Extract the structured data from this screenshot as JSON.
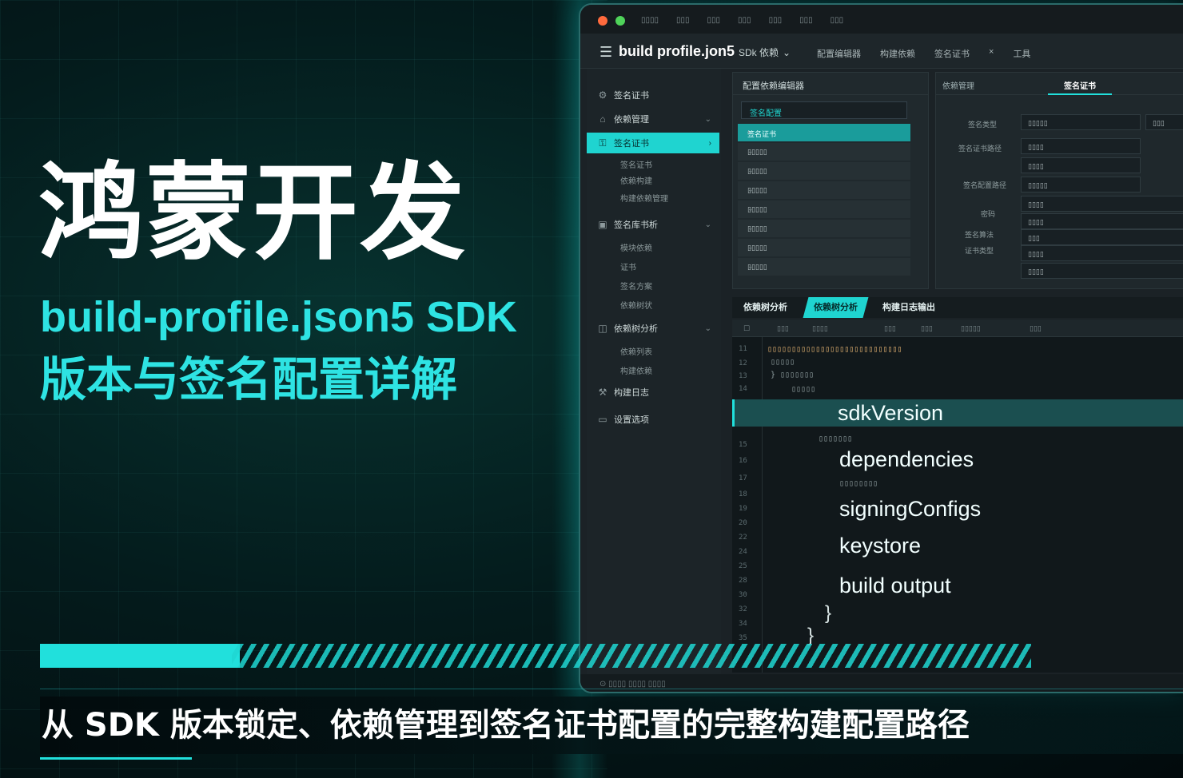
{
  "hero": {
    "title": "鸿蒙开发",
    "subtitle_line1": "build-profile.json5 SDK",
    "subtitle_line2": "版本与签名配置详解",
    "banner": "从 SDK 版本锁定、依赖管理到签名证书配置的完整构建配置路径"
  },
  "ide": {
    "toolbar_title": "build profile.jon5",
    "toolbar_suffix": "SDk 依赖",
    "toolbar_items": [
      "配置编辑器",
      "构建依赖",
      "签名证书",
      "工具"
    ],
    "sidebar": {
      "items": [
        {
          "label": "签名证书",
          "icon": "gear-icon"
        },
        {
          "label": "依赖管理",
          "icon": "home-icon"
        },
        {
          "label": "签名证书",
          "icon": "key-icon"
        },
        {
          "label": "签名库书析",
          "icon": "box-icon"
        },
        {
          "label": "依赖树分析",
          "icon": "tree-icon"
        },
        {
          "label": "构建日志",
          "icon": "log-icon"
        },
        {
          "label": "设置选项",
          "icon": "chat-icon"
        }
      ],
      "subitems": [
        "签名证书",
        "依赖构建",
        "构建依赖管理",
        "模块依赖",
        "证书",
        "签名方案",
        "依赖树状",
        "依赖列表",
        "构建依赖"
      ]
    },
    "mid_panel": {
      "header": "配置依赖编辑器",
      "select_value": "签名配置",
      "active_row": "签名证书"
    },
    "right_panel": {
      "tabs": [
        "依赖管理",
        "签名证书"
      ],
      "labels": [
        "签名类型",
        "签名证书路径",
        "签名配置路径",
        "密码",
        "签名算法",
        "证书类型"
      ]
    },
    "bottom_tabs": [
      "依赖树分析",
      "依赖树分析",
      "构建日志输出"
    ],
    "editor": {
      "keys": [
        "sdkVersion",
        "dependencies",
        "signingConfigs",
        "keystore",
        "build output"
      ],
      "line_numbers": [
        "11",
        "12",
        "13",
        "14",
        "12",
        "13",
        "15",
        "16",
        "17",
        "18",
        "19",
        "20",
        "22",
        "24",
        "25",
        "28",
        "30",
        "32",
        "34",
        "35"
      ]
    }
  }
}
